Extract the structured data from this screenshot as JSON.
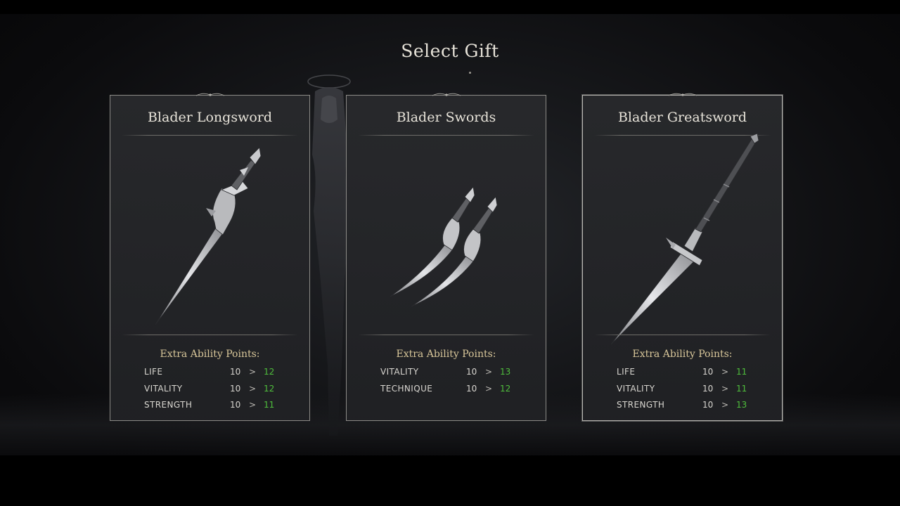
{
  "screen": {
    "title": "Select Gift"
  },
  "colors": {
    "accent_gold": "#d9c79a",
    "increase_green": "#4fbf3c",
    "card_border": "#8c8b87",
    "card_bg": "#28292c"
  },
  "cards": [
    {
      "title": "Blader Longsword",
      "icon": "longsword-icon",
      "section_label": "Extra Ability Points:",
      "stats": [
        {
          "name": "LIFE",
          "base": "10",
          "arrow": ">",
          "new": "12"
        },
        {
          "name": "VITALITY",
          "base": "10",
          "arrow": ">",
          "new": "12"
        },
        {
          "name": "STRENGTH",
          "base": "10",
          "arrow": ">",
          "new": "11"
        }
      ]
    },
    {
      "title": "Blader Swords",
      "icon": "twin-swords-icon",
      "section_label": "Extra Ability Points:",
      "stats": [
        {
          "name": "VITALITY",
          "base": "10",
          "arrow": ">",
          "new": "13"
        },
        {
          "name": "TECHNIQUE",
          "base": "10",
          "arrow": ">",
          "new": "12"
        }
      ]
    },
    {
      "title": "Blader Greatsword",
      "icon": "greatsword-icon",
      "selected": true,
      "section_label": "Extra Ability Points:",
      "stats": [
        {
          "name": "LIFE",
          "base": "10",
          "arrow": ">",
          "new": "11"
        },
        {
          "name": "VITALITY",
          "base": "10",
          "arrow": ">",
          "new": "11"
        },
        {
          "name": "STRENGTH",
          "base": "10",
          "arrow": ">",
          "new": "13"
        }
      ]
    }
  ]
}
